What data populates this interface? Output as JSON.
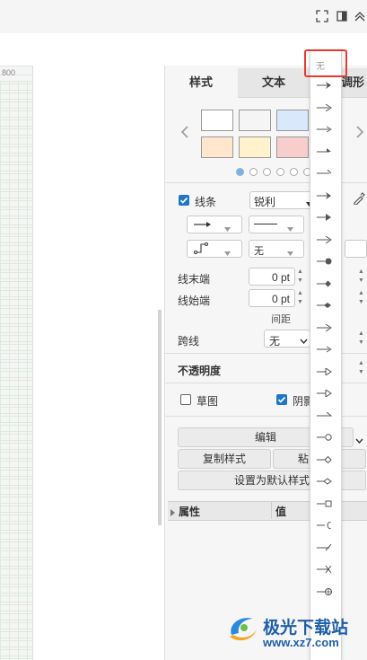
{
  "ruler": {
    "label": "800"
  },
  "tabs": [
    {
      "label": "样式",
      "active": true
    },
    {
      "label": "文本",
      "active": false
    },
    {
      "label": "调形",
      "active": false
    }
  ],
  "swatches": {
    "row1": [
      "#ffffff",
      "#f5f5f5",
      "#dae8fc"
    ],
    "row2": [
      "#ffe6cc",
      "#fff2cc",
      "#f8cecc"
    ]
  },
  "line": {
    "checkbox_label": "线条",
    "style_value": "锐利",
    "line_end_label": "线末端",
    "line_start_label": "线始端",
    "line_end_value": "0 pt",
    "line_start_value": "0 pt",
    "spacing_label": "间距",
    "none_value": "无",
    "crossing_label": "跨线",
    "crossing_value": "无"
  },
  "opacity": {
    "label": "不透明度"
  },
  "sketch": {
    "label": "草图",
    "checked": false
  },
  "shadow": {
    "label": "阴影",
    "checked": true
  },
  "actions": {
    "edit_label": "编辑",
    "copy_style_label": "复制样式",
    "paste_label": "粘",
    "default_style_label": "设置为默认样式"
  },
  "props": {
    "col1": "属性",
    "col2": "值"
  },
  "dropdown": {
    "none_label": "无",
    "items": [
      "arrow-classic",
      "arrow-open",
      "arrow-thin",
      "arrow-half",
      "arrow-line",
      "arrow-classic-2",
      "arrow-block",
      "arrow-open-2",
      "arrow-dot-solid",
      "arrow-diamond",
      "arrow-diamond-wide",
      "arrow-lines",
      "arrow-thin-2",
      "arrow-triangle-open",
      "arrow-triangle-open-2",
      "arrow-half-2",
      "arrow-circle-open",
      "arrow-diamond-open",
      "arrow-diamond-open-2",
      "arrow-square",
      "arrow-half-circle",
      "arrow-slash",
      "arrow-cross",
      "arrow-circle-plus"
    ]
  },
  "watermark": {
    "name": "极光下载站",
    "url": "www.xz7.com"
  },
  "colors": {
    "accent": "#1f76c9",
    "highlight": "#e33b2e",
    "dot_active": "#7eb3e0"
  }
}
